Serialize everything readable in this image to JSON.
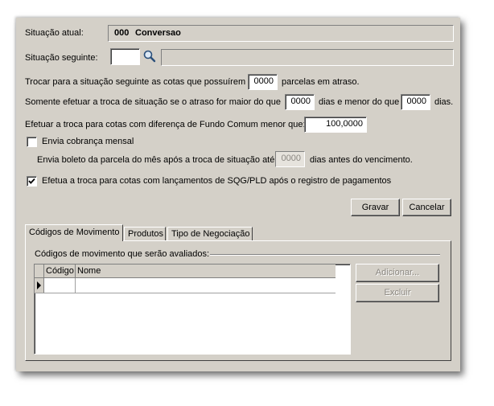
{
  "situacao_atual": {
    "label": "Situação atual:",
    "codigo": "000",
    "nome": "Conversao"
  },
  "situacao_seguinte": {
    "label": "Situação seguinte:",
    "codigo": "",
    "nome": "",
    "search_icon": "magnifier-icon"
  },
  "trocar": {
    "prefix": "Trocar para a situação seguinte as cotas que possuírem",
    "value": "0000",
    "suffix": "parcelas em atraso."
  },
  "somente": {
    "prefix": "Somente efetuar a troca de situação se o atraso for maior do que",
    "value1": "0000",
    "middle": "dias e menor do que",
    "value2": "0000",
    "suffix": "dias."
  },
  "efetuar": {
    "label": "Efetuar a troca para cotas com diferença de Fundo Comum menor que:",
    "value": "100,0000"
  },
  "cobranca": {
    "label": "Envia cobrança mensal",
    "checked": false
  },
  "boleto": {
    "prefix": "Envia boleto da parcela do mês após a troca de situação até",
    "value": "0000",
    "suffix": "dias antes do vencimento."
  },
  "sqg": {
    "label": "Efetua a troca para cotas com lançamentos de SQG/PLD após o registro de pagamentos",
    "checked": true
  },
  "buttons": {
    "gravar": "Gravar",
    "cancelar": "Cancelar"
  },
  "tabs": [
    {
      "label": "Códigos de Movimento",
      "active": true
    },
    {
      "label": "Produtos",
      "active": false
    },
    {
      "label": "Tipo de Negociação",
      "active": false
    }
  ],
  "movimento": {
    "group_label": "Códigos de movimento que serão avaliados:",
    "columns": [
      "Código",
      "Nome"
    ],
    "adicionar": "Adicionar...",
    "excluir": "Excluir"
  }
}
